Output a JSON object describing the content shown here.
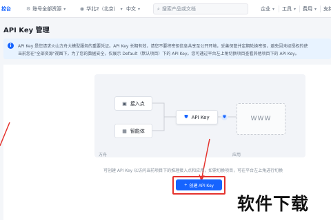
{
  "topbar": {
    "logo": "控台",
    "account": "账号全部资源",
    "region": "华北2（北京）",
    "language": "中文",
    "search_placeholder": "搜索产品或文档",
    "enterprise": "企业",
    "tools": "工具",
    "billing": "费用",
    "support": "支持"
  },
  "page": {
    "title": "API Key 管理"
  },
  "banner": {
    "line1": "API Key 是您请求火山方舟大模型服务的重要凭证。API Key 长期有效，请您不要将密钥信息共享至公开环境，妥善保管并定期轮换密钥，避免因未经授权的使",
    "line2": "当前您在\"全部资源\"视图下，为了您的数据安全，仅展示 Default（默认项目）下的 API Key。您可通过平台左上角切换项目查看其他项目下的 API Key。"
  },
  "diagram": {
    "access_point": "接入点",
    "agent": "智能体",
    "api_key": "API Key",
    "www": "WWW",
    "label_left": "方舟",
    "label_right": "应用"
  },
  "hint": "可创建 API Key 以访问当前项目下的推理接入点和应用，如需切换项目，可在平台左上角进行切换",
  "create_button": {
    "label": "创建 API Key",
    "icon": "+"
  },
  "watermark": "软件下载",
  "colors": {
    "primary": "#1664ff",
    "highlight": "#e5322d",
    "banner_bg": "#e8f3ff"
  }
}
